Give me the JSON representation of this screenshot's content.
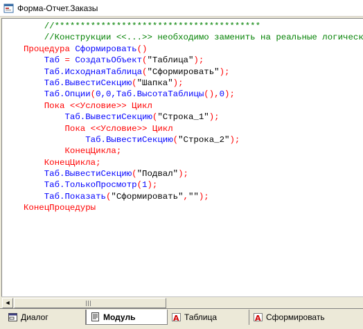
{
  "window": {
    "title": "Форма-Отчет.Заказы"
  },
  "editor": {
    "lines": [
      [
        {
          "t": "    "
        },
        {
          "c": "cm",
          "t": "//****************************************"
        }
      ],
      [
        {
          "t": "    "
        },
        {
          "c": "cm",
          "t": "//Конструкции <<...>> необходимо заменить на реальные логические"
        }
      ],
      [
        {
          "c": "kw",
          "t": "Процедура "
        },
        {
          "c": "id",
          "t": "Сформировать"
        },
        {
          "c": "kw",
          "t": "()"
        }
      ],
      [
        {
          "t": "    "
        },
        {
          "c": "id",
          "t": "Таб"
        },
        {
          "c": "kw",
          "t": " = "
        },
        {
          "c": "id",
          "t": "СоздатьОбъект"
        },
        {
          "c": "kw",
          "t": "("
        },
        {
          "c": "st",
          "t": "\"Таблица\""
        },
        {
          "c": "kw",
          "t": ");"
        }
      ],
      [
        {
          "t": "    "
        },
        {
          "c": "id",
          "t": "Таб.ИсходнаяТаблица"
        },
        {
          "c": "kw",
          "t": "("
        },
        {
          "c": "st",
          "t": "\"Сформировать\""
        },
        {
          "c": "kw",
          "t": ");"
        }
      ],
      [
        {
          "t": "    "
        },
        {
          "c": "id",
          "t": "Таб.ВывестиСекцию"
        },
        {
          "c": "kw",
          "t": "("
        },
        {
          "c": "st",
          "t": "\"Шапка\""
        },
        {
          "c": "kw",
          "t": ");"
        }
      ],
      [
        {
          "t": "    "
        },
        {
          "c": "id",
          "t": "Таб.Опции"
        },
        {
          "c": "kw",
          "t": "("
        },
        {
          "c": "id",
          "t": "0,0,Таб.ВысотаТаблицы"
        },
        {
          "c": "kw",
          "t": "(),"
        },
        {
          "c": "id",
          "t": "0"
        },
        {
          "c": "kw",
          "t": ");"
        }
      ],
      [
        {
          "t": "    "
        },
        {
          "c": "kw",
          "t": "Пока <<Условие>> Цикл"
        }
      ],
      [
        {
          "t": "        "
        },
        {
          "c": "id",
          "t": "Таб.ВывестиСекцию"
        },
        {
          "c": "kw",
          "t": "("
        },
        {
          "c": "st",
          "t": "\"Строка_1\""
        },
        {
          "c": "kw",
          "t": ");"
        }
      ],
      [
        {
          "t": "        "
        },
        {
          "c": "kw",
          "t": "Пока <<Условие>> Цикл"
        }
      ],
      [
        {
          "t": "            "
        },
        {
          "c": "id",
          "t": "Таб.ВывестиСекцию"
        },
        {
          "c": "kw",
          "t": "("
        },
        {
          "c": "st",
          "t": "\"Строка_2\""
        },
        {
          "c": "kw",
          "t": ");"
        }
      ],
      [
        {
          "t": "        "
        },
        {
          "c": "kw",
          "t": "КонецЦикла;"
        }
      ],
      [
        {
          "t": "    "
        },
        {
          "c": "kw",
          "t": "КонецЦикла;"
        }
      ],
      [
        {
          "t": "    "
        },
        {
          "c": "id",
          "t": "Таб.ВывестиСекцию"
        },
        {
          "c": "kw",
          "t": "("
        },
        {
          "c": "st",
          "t": "\"Подвал\""
        },
        {
          "c": "kw",
          "t": ");"
        }
      ],
      [
        {
          "t": "    "
        },
        {
          "c": "id",
          "t": "Таб.ТолькоПросмотр"
        },
        {
          "c": "kw",
          "t": "("
        },
        {
          "c": "id",
          "t": "1"
        },
        {
          "c": "kw",
          "t": ");"
        }
      ],
      [
        {
          "t": "    "
        },
        {
          "c": "id",
          "t": "Таб.Показать"
        },
        {
          "c": "kw",
          "t": "("
        },
        {
          "c": "st",
          "t": "\"Сформировать\""
        },
        {
          "c": "kw",
          "t": ","
        },
        {
          "c": "st",
          "t": "\"\""
        },
        {
          "c": "kw",
          "t": ");"
        }
      ],
      [
        {
          "c": "kw",
          "t": "КонецПроцедуры"
        }
      ]
    ]
  },
  "scrollbar": {
    "left_arrow": "◄"
  },
  "tabs": [
    {
      "label": "Диалог",
      "icon": "dialog-icon"
    },
    {
      "label": "Модуль",
      "icon": "module-icon",
      "active": true
    },
    {
      "label": "Таблица",
      "icon": "table-icon"
    },
    {
      "label": "Сформировать",
      "icon": "table-icon"
    }
  ],
  "colors": {
    "comment": "#008000",
    "keyword": "#ff0000",
    "identifier": "#0000ff",
    "string": "#000000"
  }
}
